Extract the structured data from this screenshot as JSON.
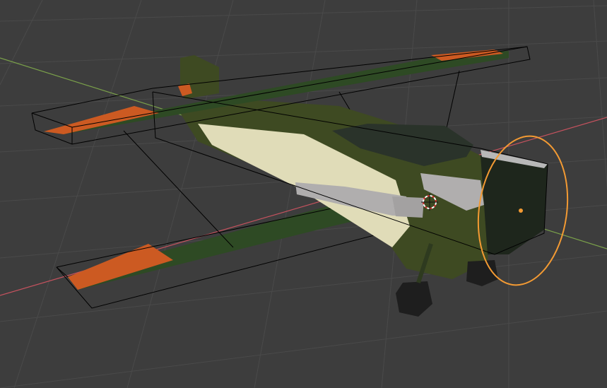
{
  "viewport": {
    "mode": "3d-viewport",
    "selected_object": "propeller-circle",
    "colors": {
      "background": "#3d3d3d",
      "grid": "#4a4a4a",
      "axis_x": "#c4525e",
      "axis_y": "#7aa04a",
      "wireframe": "#000000",
      "selection": "#f39a33",
      "body_green": "#3e4a22",
      "wing_green": "#2e4a24",
      "stripe_orange": "#cc5a22",
      "cream": "#e0dcb8",
      "canopy": "#2a332a",
      "propeller_grey": "#b0aeae",
      "wheel": "#1e1e1e"
    },
    "icons": [
      "3d-cursor-icon",
      "origin-dot-icon"
    ]
  }
}
